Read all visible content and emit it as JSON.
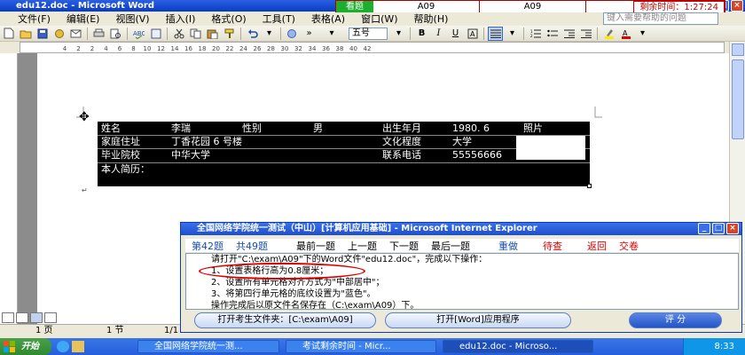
{
  "window": {
    "title": "edu12.doc - Microsoft Word"
  },
  "exam_bar": {
    "label": "看题",
    "cells": [
      "A09",
      "A09"
    ],
    "remaining": "剩余时间：1:27:24"
  },
  "menu": {
    "items": [
      "文件(F)",
      "编辑(E)",
      "视图(V)",
      "插入(I)",
      "格式(O)",
      "工具(T)",
      "表格(A)",
      "窗口(W)",
      "帮助(H)"
    ],
    "help_placeholder": "键入需要帮助的问题"
  },
  "toolbar": {
    "font_size": "五号"
  },
  "ruler": {
    "marks": [
      "4",
      "2",
      "2",
      "4",
      "6",
      "8",
      "10",
      "12",
      "14",
      "16",
      "18",
      "20",
      "22",
      "24",
      "26",
      "28",
      "30",
      "32",
      "34",
      "36",
      "38",
      "40",
      "42"
    ]
  },
  "table": {
    "row1": [
      "姓名",
      "李瑞",
      "性别",
      "男",
      "出生年月",
      "1980. 6",
      "照片"
    ],
    "row2": [
      "家庭住址",
      "丁香花园 6 号楼",
      "文化程度",
      "大学"
    ],
    "row3": [
      "毕业院校",
      "中华大学",
      "联系电话",
      "55556666"
    ],
    "row4": [
      "本人简历："
    ]
  },
  "status": {
    "page": "1 页",
    "section": "1 节",
    "pages": "1/1"
  },
  "dialog": {
    "title": "全国网络学院统一测试（中山）[计算机应用基础] - Microsoft Internet Explorer",
    "current": "第42题",
    "total": "共49题",
    "nav": [
      "最前一题",
      "上一题",
      "下一题",
      "最后一题"
    ],
    "actions": [
      "重做",
      "待查",
      "返回",
      "交卷"
    ],
    "instructions": [
      "请打开\"C:\\exam\\A09\"下的Word文件\"edu12.doc\"，完成以下操作：",
      "1、设置表格行高为0.8厘米；",
      "2、设置所有单元格对齐方式为\"中部居中\"；",
      "3、将第四行单元格的底纹设置为\"蓝色\"。",
      "操作完成后以原文件名保存在（C:\\exam\\A09）下。"
    ],
    "open_folder": "打开考生文件夹：[C:\\exam\\A09]",
    "open_word": "打开[Word]应用程序",
    "grade": "评 分"
  },
  "taskbar": {
    "start": "开始",
    "tasks": [
      "全国网络学院统一测...",
      "考试剩余时间 - Micr...",
      "edu12.doc - Microso..."
    ],
    "clock": "8:33"
  }
}
